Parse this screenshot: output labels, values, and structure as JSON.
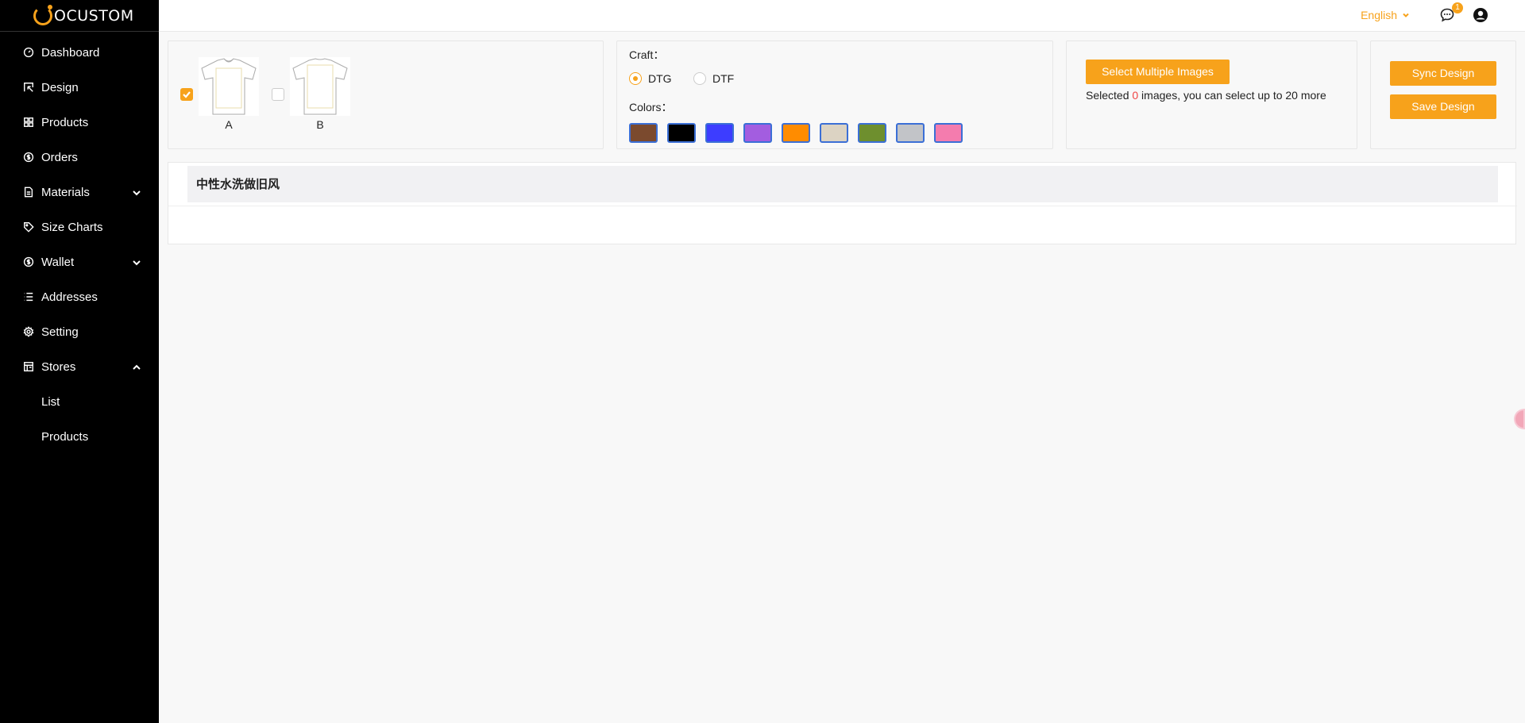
{
  "brand": {
    "logo_text": "OCUSTOM",
    "accent": "#f7a21b"
  },
  "sidebar": {
    "items": [
      {
        "label": "Dashboard",
        "icon": "dashboard-icon"
      },
      {
        "label": "Design",
        "icon": "design-icon"
      },
      {
        "label": "Products",
        "icon": "grid-icon"
      },
      {
        "label": "Orders",
        "icon": "dollar-circle-icon"
      },
      {
        "label": "Materials",
        "icon": "file-icon",
        "expand": "chevron-down-icon"
      },
      {
        "label": "Size Charts",
        "icon": "tag-icon"
      },
      {
        "label": "Wallet",
        "icon": "dollar-circle-icon",
        "expand": "chevron-down-icon"
      },
      {
        "label": "Addresses",
        "icon": "list-icon"
      },
      {
        "label": "Setting",
        "icon": "gear-icon"
      },
      {
        "label": "Stores",
        "icon": "store-icon",
        "expand": "chevron-up-icon"
      }
    ],
    "sub_items": [
      {
        "label": "List"
      },
      {
        "label": "Products"
      }
    ]
  },
  "header": {
    "language": "English",
    "message_badge": "1"
  },
  "templates": [
    {
      "label": "A",
      "checked": true
    },
    {
      "label": "B",
      "checked": false
    }
  ],
  "craft": {
    "label": "Craft：",
    "options": [
      "DTG",
      "DTF"
    ],
    "selected": "DTG"
  },
  "colors": {
    "label": "Colors：",
    "swatches": [
      "#7b4a2e",
      "#000000",
      "#3d3dff",
      "#a35de0",
      "#ff8c00",
      "#dcd3c3",
      "#6e8f2e",
      "#c2c4c8",
      "#f47cae"
    ]
  },
  "images": {
    "select_button": "Select Multiple Images",
    "desc_prefix": "Selected ",
    "selected_count": "0",
    "desc_suffix": " images, you can select up to 20 more"
  },
  "actions": {
    "sync": "Sync Design",
    "save": "Save Design"
  },
  "panel": {
    "title": "中性水洗做旧风"
  }
}
